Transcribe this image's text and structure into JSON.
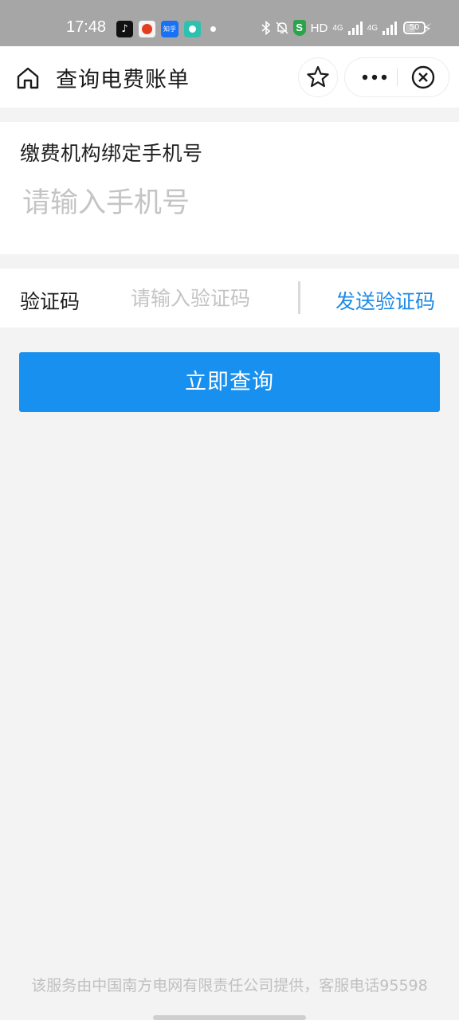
{
  "status_bar": {
    "time": "17:48",
    "hd_label": "HD",
    "network_1": "4G",
    "network_2": "4G",
    "battery_level": "50",
    "icons": [
      "tiktok-icon",
      "weibo-icon",
      "zhihu-icon",
      "app-icon",
      "bluetooth-icon",
      "mute-icon",
      "shield-icon",
      "signal-icon",
      "battery-icon",
      "charging-icon"
    ],
    "zhihu_text": "知乎",
    "shield_text": "S"
  },
  "nav": {
    "title": "查询电费账单",
    "icons": [
      "home-icon",
      "star-icon",
      "more-icon",
      "close-icon"
    ]
  },
  "form": {
    "phone_label": "缴费机构绑定手机号",
    "phone_placeholder": "请输入手机号",
    "phone_value": "",
    "code_label": "验证码",
    "code_placeholder": "请输入验证码",
    "code_value": "",
    "send_code_label": "发送验证码",
    "submit_label": "立即查询"
  },
  "footer": {
    "text": "该服务由中国南方电网有限责任公司提供，客服电话95598"
  },
  "colors": {
    "accent": "#1890f0",
    "link": "#1e8ae6",
    "background": "#f3f3f3",
    "status_bar": "#a6a6a6"
  }
}
